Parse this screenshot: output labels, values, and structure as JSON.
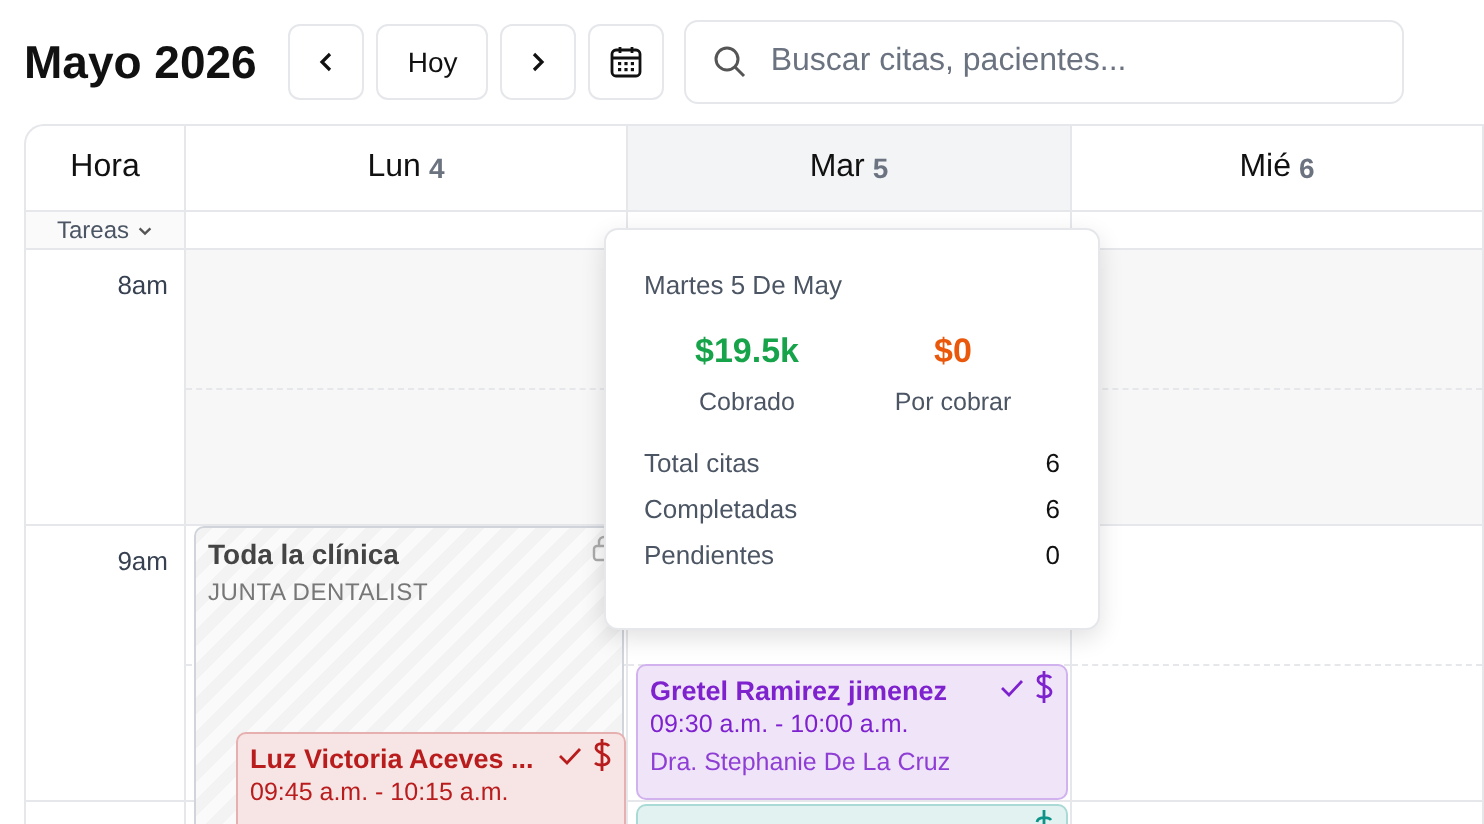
{
  "header": {
    "title": "Mayo 2026",
    "today_button": "Hoy",
    "search": {
      "placeholder": "Buscar citas, pacientes..."
    }
  },
  "calendar": {
    "hour_column": "Hora",
    "tasks_toggle": "Tareas",
    "days": [
      {
        "name": "Lun",
        "number": "4",
        "selected": false
      },
      {
        "name": "Mar",
        "number": "5",
        "selected": true
      },
      {
        "name": "Mié",
        "number": "6",
        "selected": false
      }
    ],
    "hours": [
      "8am",
      "9am"
    ],
    "events": [
      {
        "kind": "block",
        "title": "Toda la clínica",
        "subtitle": "JUNTA DENTALIST"
      },
      {
        "kind": "appointment",
        "color": "#b91c1c",
        "title": "Luz Victoria Aceves ...",
        "time": "09:45 a.m. - 10:15 a.m."
      },
      {
        "kind": "appointment",
        "color": "#7e22ce",
        "title": "Gretel Ramirez jimenez",
        "time": "09:30 a.m. - 10:00 a.m.",
        "doctor": "Dra. Stephanie De La Cruz"
      },
      {
        "kind": "appointment",
        "color": "#0d9488"
      }
    ]
  },
  "day_popover": {
    "title": "Martes 5 De May",
    "totals": [
      {
        "value": "$19.5k",
        "label": "Cobrado",
        "color": "#16a34a"
      },
      {
        "value": "$0",
        "label": "Por cobrar",
        "color": "#ea580c"
      }
    ],
    "stats": [
      {
        "label": "Total citas",
        "value": "6"
      },
      {
        "label": "Completadas",
        "value": "6"
      },
      {
        "label": "Pendientes",
        "value": "0"
      }
    ]
  }
}
